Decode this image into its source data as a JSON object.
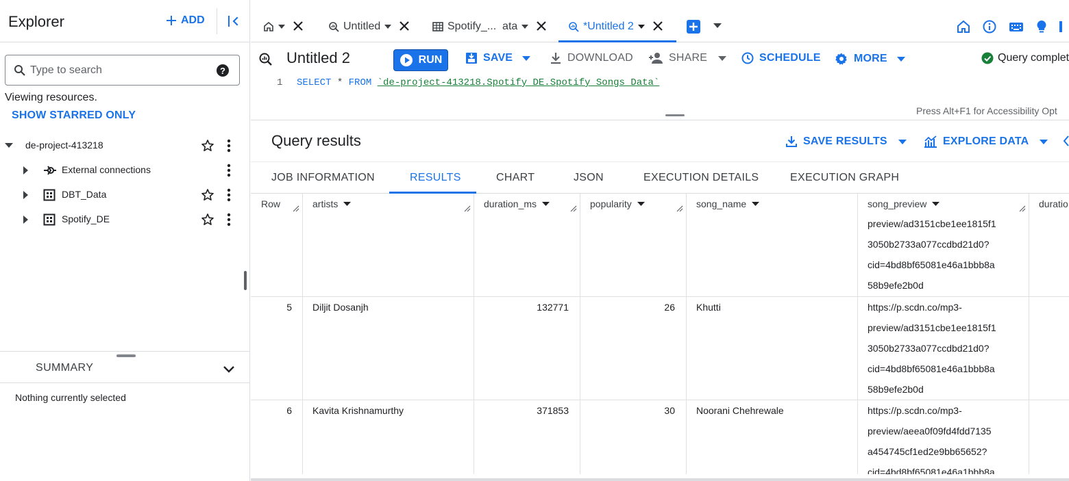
{
  "explorer": {
    "title": "Explorer",
    "add_label": "ADD",
    "search_placeholder": "Type to search",
    "viewing_text": "Viewing resources.",
    "starred_label": "SHOW STARRED ONLY",
    "project": "de-project-413218",
    "items": [
      {
        "label": "External connections",
        "icon": "external-connection-icon"
      },
      {
        "label": "DBT_Data",
        "icon": "dataset-icon"
      },
      {
        "label": "Spotify_DE",
        "icon": "dataset-icon"
      }
    ],
    "summary_label": "SUMMARY",
    "summary_text": "Nothing currently selected"
  },
  "tabs": [
    {
      "label": "Untitled",
      "icon": "query-icon"
    },
    {
      "label": "Spotify_...  ata",
      "icon": "table-icon"
    },
    {
      "label": "*Untitled 2",
      "icon": "query-icon",
      "active": true
    }
  ],
  "editor": {
    "title": "Untitled 2",
    "run_label": "RUN",
    "save_label": "SAVE",
    "download_label": "DOWNLOAD",
    "share_label": "SHARE",
    "schedule_label": "SCHEDULE",
    "more_label": "MORE",
    "status_text": "Query complet",
    "line_number": "1",
    "code_kw1": "SELECT",
    "code_op": " * ",
    "code_kw2": "FROM",
    "code_table": "`de-project-413218.Spotify_DE.Spotify_Songs_Data`",
    "accessibility_hint": "Press Alt+F1 for Accessibility Opt"
  },
  "results": {
    "title": "Query results",
    "save_results_label": "SAVE RESULTS",
    "explore_data_label": "EXPLORE DATA",
    "tabs": [
      "JOB INFORMATION",
      "RESULTS",
      "CHART",
      "JSON",
      "EXECUTION DETAILS",
      "EXECUTION GRAPH"
    ],
    "columns": [
      "Row",
      "artists",
      "duration_ms",
      "popularity",
      "song_name",
      "song_preview",
      "duratio"
    ],
    "partial_row_preview": [
      "preview/ad3151cbe1ee1815f1",
      "3050b2733a077ccdbd21d0?",
      "cid=4bd8bf65081e46a1bbb8a",
      "58b9efe2b0d"
    ],
    "rows": [
      {
        "row": "5",
        "artists": "Diljit Dosanjh",
        "duration_ms": "132771",
        "popularity": "26",
        "song_name": "Khutti",
        "song_preview": [
          "https://p.scdn.co/mp3-",
          "preview/ad3151cbe1ee1815f1",
          "3050b2733a077ccdbd21d0?",
          "cid=4bd8bf65081e46a1bbb8a",
          "58b9efe2b0d"
        ]
      },
      {
        "row": "6",
        "artists": "Kavita Krishnamurthy",
        "duration_ms": "371853",
        "popularity": "30",
        "song_name": "Noorani Chehrewale",
        "song_preview": [
          "https://p.scdn.co/mp3-",
          "preview/aeea0f09fd4fdd7135",
          "a454745cf1ed2e9bb65652?",
          "cid=4bd8bf65081e46a1bbb8a"
        ]
      }
    ]
  },
  "colors": {
    "accent": "#1a73e8",
    "success": "#188038",
    "text": "#202124"
  }
}
